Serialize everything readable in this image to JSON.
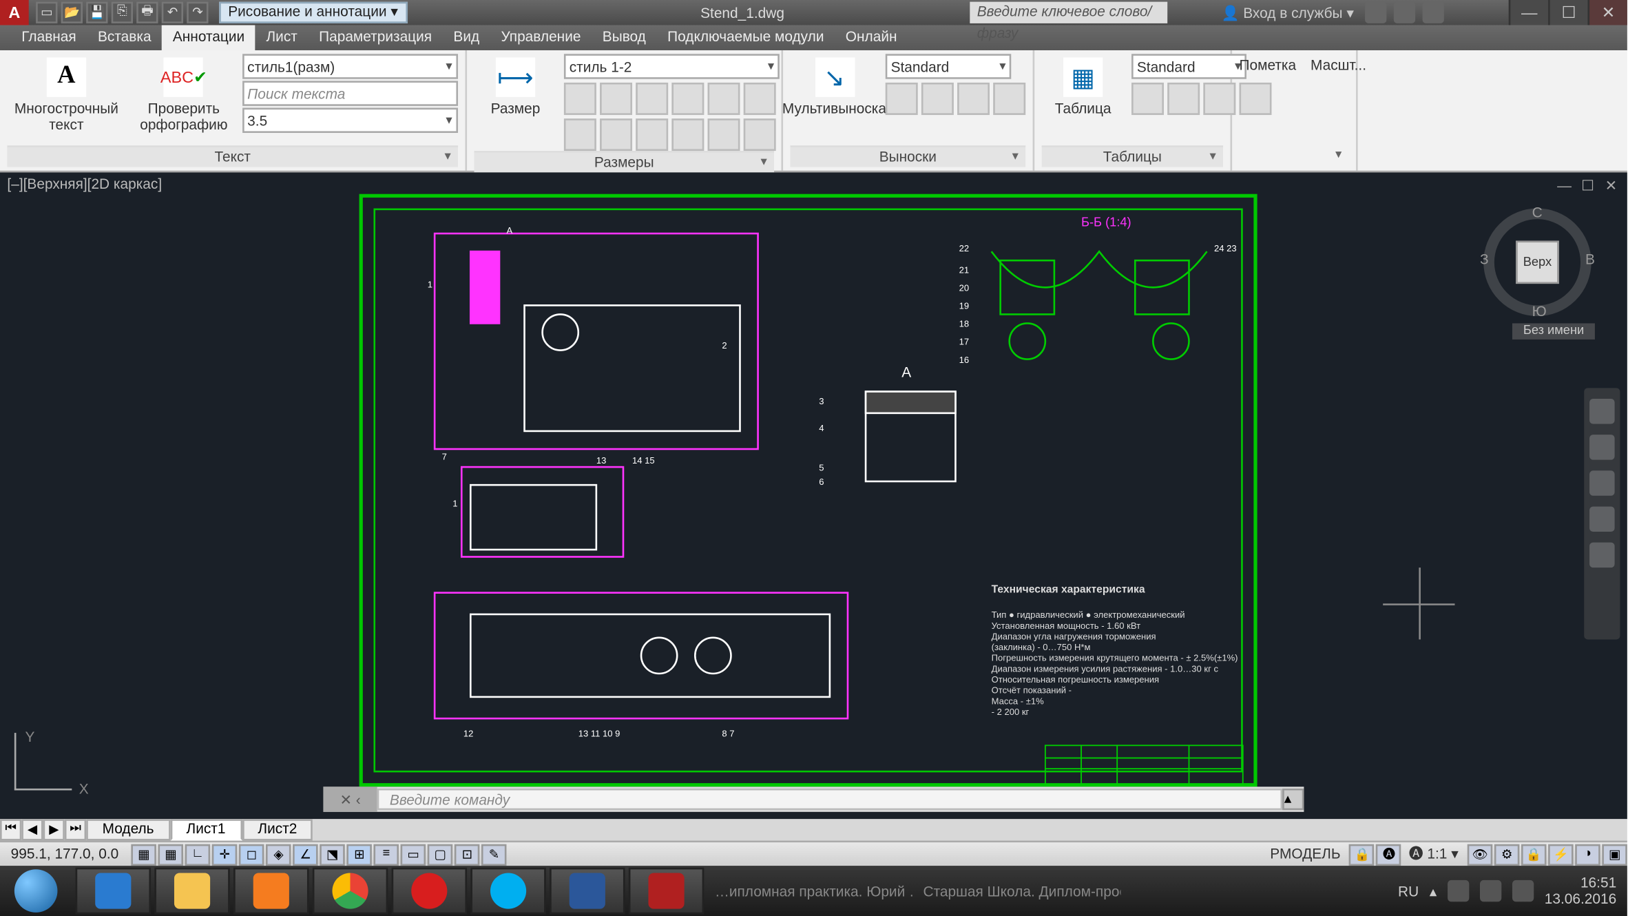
{
  "title": {
    "workspace_label": "Рисование и аннотации",
    "doc_name": "Stend_1.dwg",
    "search_placeholder": "Введите ключевое слово/фразу",
    "login_label": "Вход в службы",
    "app_letter": "A"
  },
  "tabs": {
    "t0": "Главная",
    "t1": "Вставка",
    "t2": "Аннотации",
    "t3": "Лист",
    "t4": "Параметризация",
    "t5": "Вид",
    "t6": "Управление",
    "t7": "Вывод",
    "t8": "Подключаемые модули",
    "t9": "Онлайн"
  },
  "ribbon": {
    "text_panel": {
      "multiline_text": "Многострочный\nтекст",
      "spellcheck": "Проверить\nорфографию",
      "style_combo": "стиль1(разм)",
      "search_placeholder": "Поиск текста",
      "height_value": "3.5",
      "title": "Текст"
    },
    "dim_panel": {
      "dimension": "Размер",
      "style_combo": "стиль 1-2",
      "title": "Размеры"
    },
    "leader_panel": {
      "multileader": "Мультивыноска",
      "style_combo": "Standard",
      "title": "Выноски"
    },
    "table_panel": {
      "table": "Таблица",
      "style_combo": "Standard",
      "title": "Таблицы"
    },
    "markup_panel": {
      "label": "Пометка"
    },
    "scale_panel": {
      "label": "Масшт..."
    }
  },
  "viewport": {
    "label": "[–][Верхняя][2D каркас]",
    "section_label": "Б-Б (1:4)",
    "detail_label": "А",
    "viewcube_top": "Верх",
    "dir_n": "С",
    "dir_s": "Ю",
    "dir_e": "В",
    "dir_w": "З",
    "vc_unnamed": "Без имени",
    "techspec": {
      "header": "Техническая характеристика",
      "body": "Тип ● гидравлический ● электромеханический\nУстановленная мощность                       - 1.60 кВт\nДиапазон угла нагружения торможения\n(заклинка)                                         - 0…750 Н*м\nПогрешность измерения крутящего момента   - ± 2.5%(±1%)\nДиапазон измерения усилия растяжения        - 1.0…30 кг с\nОтносительная погрешность измерения\nОтсчёт показаний                                    -\nМасса                                              - ±1%\n                                                   - 2 200 кг"
    }
  },
  "cmdline": {
    "prompt": "Введите команду"
  },
  "layout_tabs": {
    "model": "Модель",
    "l1": "Лист1",
    "l2": "Лист2"
  },
  "statusbar": {
    "coords": "995.1,  177.0, 0.0",
    "rmodel": "РМОДЕЛЬ",
    "scale": "1:1"
  },
  "taskbar": {
    "lang": "RU",
    "time": "16:51",
    "date": "13.06.2016",
    "task1": "…ипломная практика. Юрий …",
    "task2": "Старшая Школа. Диплом-проект…"
  }
}
